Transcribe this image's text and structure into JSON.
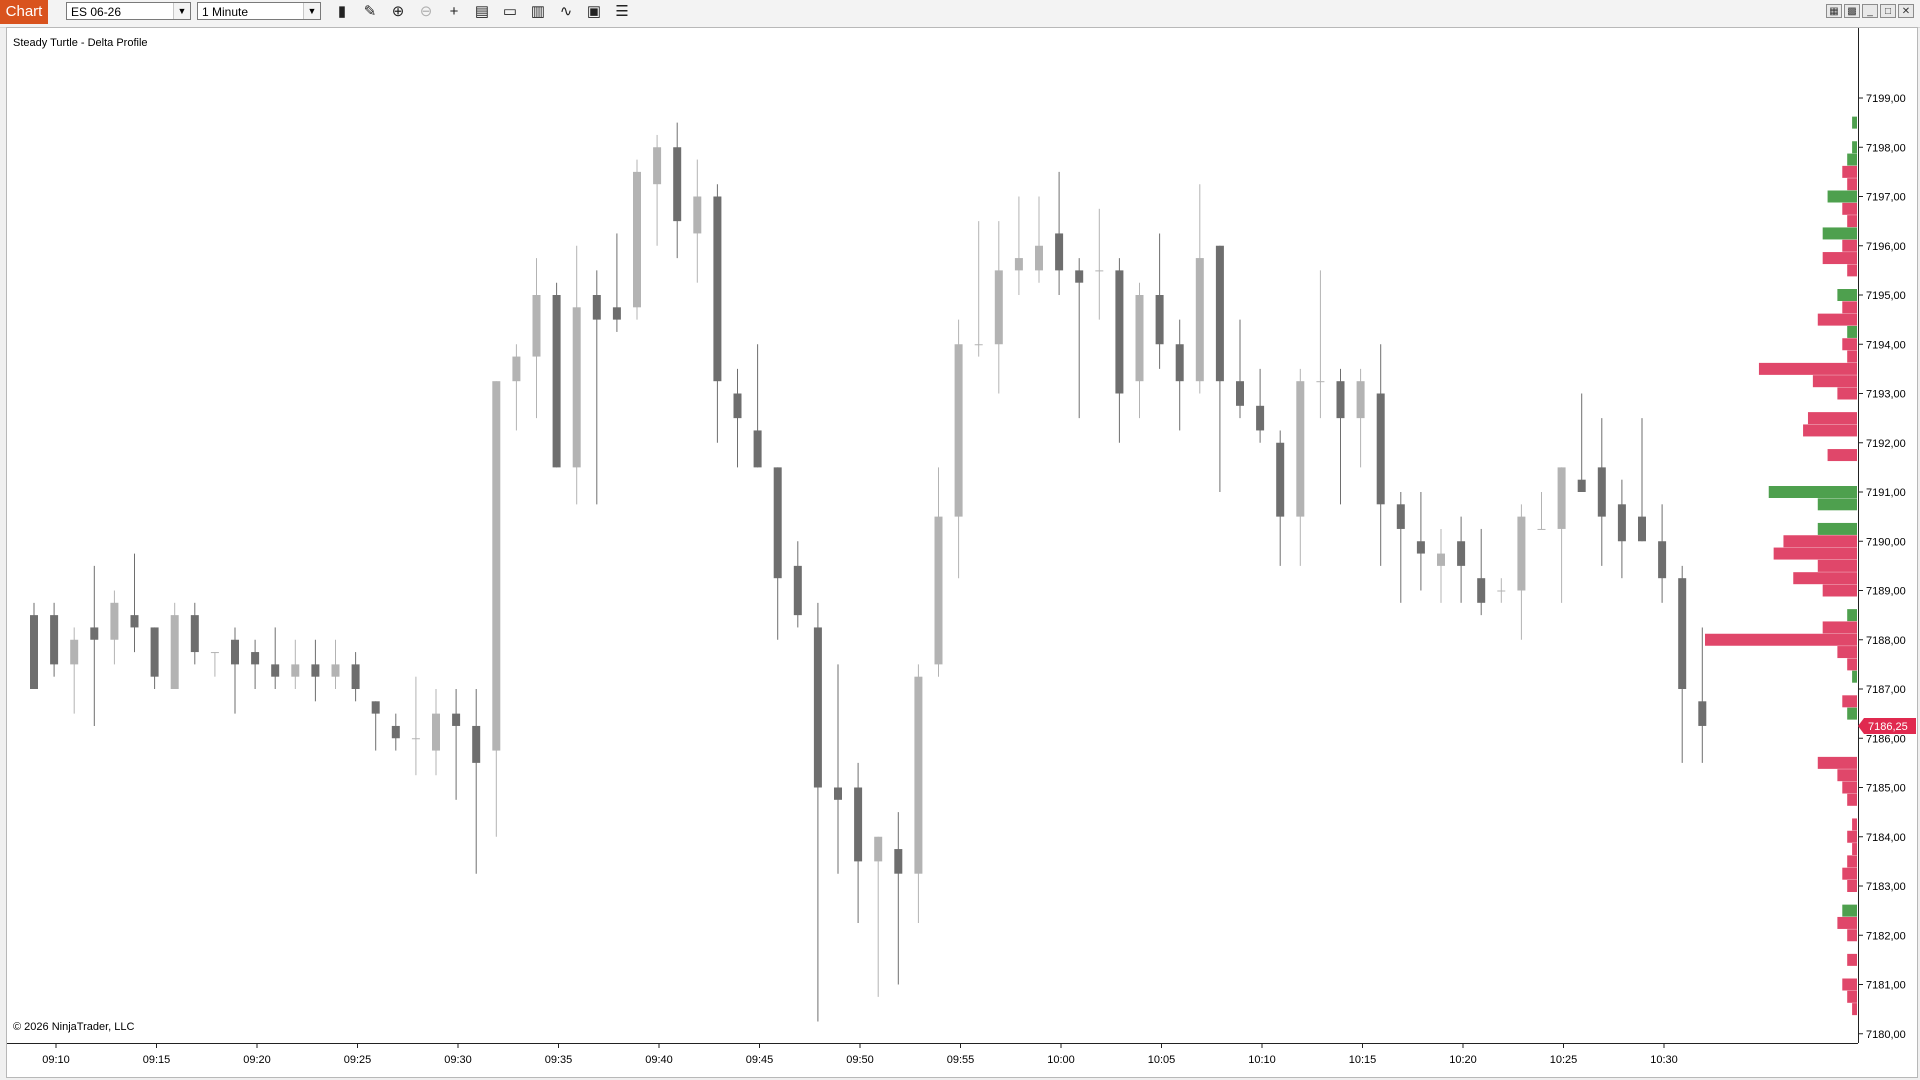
{
  "toolbar": {
    "chart_tab": "Chart",
    "instrument": "ES 06-26",
    "interval": "1 Minute",
    "tools": [
      {
        "name": "bars-type-icon",
        "glyph": "▮",
        "enabled": true
      },
      {
        "name": "draw-tool-icon",
        "glyph": "✎",
        "enabled": true
      },
      {
        "name": "zoom-in-icon",
        "glyph": "⊕",
        "enabled": true
      },
      {
        "name": "zoom-out-icon",
        "glyph": "⊖",
        "enabled": false
      },
      {
        "name": "crosshair-icon",
        "glyph": "+",
        "enabled": true
      },
      {
        "name": "data-box-icon",
        "glyph": "▤",
        "enabled": true
      },
      {
        "name": "chart-trader-icon",
        "glyph": "▭",
        "enabled": true
      },
      {
        "name": "indicators-icon",
        "glyph": "▥",
        "enabled": true
      },
      {
        "name": "strategies-icon",
        "glyph": "∿",
        "enabled": true
      },
      {
        "name": "templates-icon",
        "glyph": "▣",
        "enabled": true
      },
      {
        "name": "properties-icon",
        "glyph": "☰",
        "enabled": true
      }
    ],
    "window_buttons": [
      {
        "name": "tile-icon",
        "glyph": "▦"
      },
      {
        "name": "link-icon",
        "glyph": "▩"
      },
      {
        "name": "minimize-icon",
        "glyph": "_"
      },
      {
        "name": "maximize-icon",
        "glyph": "□"
      },
      {
        "name": "close-icon",
        "glyph": "✕"
      }
    ]
  },
  "chart": {
    "indicator_label": "Steady Turtle - Delta Profile",
    "copyright": "© 2026 NinjaTrader, LLC",
    "current_price_label": "7186,25",
    "colors": {
      "candle_down": "#6e6e6e",
      "candle_up": "#b3b3b3",
      "delta_negative": "#e0476a",
      "delta_positive": "#4ea04e",
      "price_marker": "#e0294f"
    }
  },
  "chart_data": {
    "type": "candlestick",
    "instrument": "ES 06-26",
    "interval": "1 Minute",
    "x_ticks": [
      "09:10",
      "09:15",
      "09:20",
      "09:25",
      "09:30",
      "09:35",
      "09:40",
      "09:45",
      "09:50",
      "09:55",
      "10:00",
      "10:05",
      "10:10",
      "10:15",
      "10:20",
      "10:25",
      "10:30"
    ],
    "y_ticks": [
      "7180,00",
      "7181,00",
      "7182,00",
      "7183,00",
      "7184,00",
      "7185,00",
      "7186,00",
      "7187,00",
      "7188,00",
      "7189,00",
      "7190,00",
      "7191,00",
      "7192,00",
      "7193,00",
      "7194,00",
      "7195,00",
      "7196,00",
      "7197,00",
      "7198,00",
      "7199,00"
    ],
    "ylim": [
      7179.5,
      7199.5
    ],
    "current_price": 7186.25,
    "candles": [
      {
        "t": "09:09",
        "o": 7188.5,
        "h": 7188.75,
        "l": 7187.0,
        "c": 7187.0
      },
      {
        "t": "09:10",
        "o": 7188.5,
        "h": 7188.75,
        "l": 7187.25,
        "c": 7187.5
      },
      {
        "t": "09:11",
        "o": 7187.5,
        "h": 7188.25,
        "l": 7186.5,
        "c": 7188.0
      },
      {
        "t": "09:12",
        "o": 7188.25,
        "h": 7189.5,
        "l": 7186.25,
        "c": 7188.0
      },
      {
        "t": "09:13",
        "o": 7188.0,
        "h": 7189.0,
        "l": 7187.5,
        "c": 7188.75
      },
      {
        "t": "09:14",
        "o": 7188.5,
        "h": 7189.75,
        "l": 7187.75,
        "c": 7188.25
      },
      {
        "t": "09:15",
        "o": 7188.25,
        "h": 7188.25,
        "l": 7187.0,
        "c": 7187.25
      },
      {
        "t": "09:16",
        "o": 7187.0,
        "h": 7188.75,
        "l": 7187.0,
        "c": 7188.5
      },
      {
        "t": "09:17",
        "o": 7188.5,
        "h": 7188.75,
        "l": 7187.5,
        "c": 7187.75
      },
      {
        "t": "09:18",
        "o": 7187.75,
        "h": 7187.75,
        "l": 7187.25,
        "c": 7187.75
      },
      {
        "t": "09:19",
        "o": 7188.0,
        "h": 7188.25,
        "l": 7186.5,
        "c": 7187.5
      },
      {
        "t": "09:20",
        "o": 7187.75,
        "h": 7188.0,
        "l": 7187.0,
        "c": 7187.5
      },
      {
        "t": "09:21",
        "o": 7187.5,
        "h": 7188.25,
        "l": 7187.0,
        "c": 7187.25
      },
      {
        "t": "09:22",
        "o": 7187.25,
        "h": 7188.0,
        "l": 7187.0,
        "c": 7187.5
      },
      {
        "t": "09:23",
        "o": 7187.5,
        "h": 7188.0,
        "l": 7186.75,
        "c": 7187.25
      },
      {
        "t": "09:24",
        "o": 7187.25,
        "h": 7188.0,
        "l": 7187.0,
        "c": 7187.5
      },
      {
        "t": "09:25",
        "o": 7187.5,
        "h": 7187.75,
        "l": 7186.75,
        "c": 7187.0
      },
      {
        "t": "09:26",
        "o": 7186.75,
        "h": 7186.75,
        "l": 7185.75,
        "c": 7186.5
      },
      {
        "t": "09:27",
        "o": 7186.25,
        "h": 7186.5,
        "l": 7185.75,
        "c": 7186.0
      },
      {
        "t": "09:28",
        "o": 7186.0,
        "h": 7187.25,
        "l": 7185.25,
        "c": 7186.0
      },
      {
        "t": "09:29",
        "o": 7185.75,
        "h": 7187.0,
        "l": 7185.25,
        "c": 7186.5
      },
      {
        "t": "09:30",
        "o": 7186.5,
        "h": 7187.0,
        "l": 7184.75,
        "c": 7186.25
      },
      {
        "t": "09:31",
        "o": 7186.25,
        "h": 7187.0,
        "l": 7183.25,
        "c": 7185.5
      },
      {
        "t": "09:32",
        "o": 7185.75,
        "h": 7193.25,
        "l": 7184.0,
        "c": 7193.25
      },
      {
        "t": "09:33",
        "o": 7193.25,
        "h": 7194.0,
        "l": 7192.25,
        "c": 7193.75
      },
      {
        "t": "09:34",
        "o": 7193.75,
        "h": 7195.75,
        "l": 7192.5,
        "c": 7195.0
      },
      {
        "t": "09:35",
        "o": 7195.0,
        "h": 7195.25,
        "l": 7191.5,
        "c": 7191.5
      },
      {
        "t": "09:36",
        "o": 7191.5,
        "h": 7196.0,
        "l": 7190.75,
        "c": 7194.75
      },
      {
        "t": "09:37",
        "o": 7195.0,
        "h": 7195.5,
        "l": 7190.75,
        "c": 7194.5
      },
      {
        "t": "09:38",
        "o": 7194.75,
        "h": 7196.25,
        "l": 7194.25,
        "c": 7194.5
      },
      {
        "t": "09:39",
        "o": 7194.75,
        "h": 7197.75,
        "l": 7194.5,
        "c": 7197.5
      },
      {
        "t": "09:40",
        "o": 7197.25,
        "h": 7198.25,
        "l": 7196.0,
        "c": 7198.0
      },
      {
        "t": "09:41",
        "o": 7198.0,
        "h": 7198.5,
        "l": 7195.75,
        "c": 7196.5
      },
      {
        "t": "09:42",
        "o": 7196.25,
        "h": 7197.75,
        "l": 7195.25,
        "c": 7197.0
      },
      {
        "t": "09:43",
        "o": 7197.0,
        "h": 7197.25,
        "l": 7192.0,
        "c": 7193.25
      },
      {
        "t": "09:44",
        "o": 7193.0,
        "h": 7193.5,
        "l": 7191.5,
        "c": 7192.5
      },
      {
        "t": "09:45",
        "o": 7192.25,
        "h": 7194.0,
        "l": 7191.5,
        "c": 7191.5
      },
      {
        "t": "09:46",
        "o": 7191.5,
        "h": 7191.5,
        "l": 7188.0,
        "c": 7189.25
      },
      {
        "t": "09:47",
        "o": 7189.5,
        "h": 7190.0,
        "l": 7188.25,
        "c": 7188.5
      },
      {
        "t": "09:48",
        "o": 7188.25,
        "h": 7188.75,
        "l": 7180.25,
        "c": 7185.0
      },
      {
        "t": "09:49",
        "o": 7185.0,
        "h": 7187.5,
        "l": 7183.25,
        "c": 7184.75
      },
      {
        "t": "09:50",
        "o": 7185.0,
        "h": 7185.5,
        "l": 7182.25,
        "c": 7183.5
      },
      {
        "t": "09:51",
        "o": 7183.5,
        "h": 7184.0,
        "l": 7180.75,
        "c": 7184.0
      },
      {
        "t": "09:52",
        "o": 7183.75,
        "h": 7184.5,
        "l": 7181.0,
        "c": 7183.25
      },
      {
        "t": "09:53",
        "o": 7183.25,
        "h": 7187.5,
        "l": 7182.25,
        "c": 7187.25
      },
      {
        "t": "09:54",
        "o": 7187.5,
        "h": 7191.5,
        "l": 7187.25,
        "c": 7190.5
      },
      {
        "t": "09:55",
        "o": 7190.5,
        "h": 7194.5,
        "l": 7189.25,
        "c": 7194.0
      },
      {
        "t": "09:56",
        "o": 7194.0,
        "h": 7196.5,
        "l": 7193.75,
        "c": 7194.0
      },
      {
        "t": "09:57",
        "o": 7194.0,
        "h": 7196.5,
        "l": 7193.0,
        "c": 7195.5
      },
      {
        "t": "09:58",
        "o": 7195.5,
        "h": 7197.0,
        "l": 7195.0,
        "c": 7195.75
      },
      {
        "t": "09:59",
        "o": 7195.5,
        "h": 7197.0,
        "l": 7195.25,
        "c": 7196.0
      },
      {
        "t": "10:00",
        "o": 7196.25,
        "h": 7197.5,
        "l": 7195.0,
        "c": 7195.5
      },
      {
        "t": "10:01",
        "o": 7195.5,
        "h": 7195.75,
        "l": 7192.5,
        "c": 7195.25
      },
      {
        "t": "10:02",
        "o": 7195.5,
        "h": 7196.75,
        "l": 7194.5,
        "c": 7195.5
      },
      {
        "t": "10:03",
        "o": 7195.5,
        "h": 7195.75,
        "l": 7192.0,
        "c": 7193.0
      },
      {
        "t": "10:04",
        "o": 7193.25,
        "h": 7195.25,
        "l": 7192.5,
        "c": 7195.0
      },
      {
        "t": "10:05",
        "o": 7195.0,
        "h": 7196.25,
        "l": 7193.5,
        "c": 7194.0
      },
      {
        "t": "10:06",
        "o": 7194.0,
        "h": 7194.5,
        "l": 7192.25,
        "c": 7193.25
      },
      {
        "t": "10:07",
        "o": 7193.25,
        "h": 7197.25,
        "l": 7193.0,
        "c": 7195.75
      },
      {
        "t": "10:08",
        "o": 7196.0,
        "h": 7196.0,
        "l": 7191.0,
        "c": 7193.25
      },
      {
        "t": "10:09",
        "o": 7193.25,
        "h": 7194.5,
        "l": 7192.5,
        "c": 7192.75
      },
      {
        "t": "10:10",
        "o": 7192.75,
        "h": 7193.5,
        "l": 7192.0,
        "c": 7192.25
      },
      {
        "t": "10:11",
        "o": 7192.0,
        "h": 7192.25,
        "l": 7189.5,
        "c": 7190.5
      },
      {
        "t": "10:12",
        "o": 7190.5,
        "h": 7193.5,
        "l": 7189.5,
        "c": 7193.25
      },
      {
        "t": "10:13",
        "o": 7193.25,
        "h": 7195.5,
        "l": 7192.5,
        "c": 7193.25
      },
      {
        "t": "10:14",
        "o": 7193.25,
        "h": 7193.5,
        "l": 7190.75,
        "c": 7192.5
      },
      {
        "t": "10:15",
        "o": 7192.5,
        "h": 7193.5,
        "l": 7191.5,
        "c": 7193.25
      },
      {
        "t": "10:16",
        "o": 7193.0,
        "h": 7194.0,
        "l": 7189.5,
        "c": 7190.75
      },
      {
        "t": "10:17",
        "o": 7190.75,
        "h": 7191.0,
        "l": 7188.75,
        "c": 7190.25
      },
      {
        "t": "10:18",
        "o": 7190.0,
        "h": 7191.0,
        "l": 7189.0,
        "c": 7189.75
      },
      {
        "t": "10:19",
        "o": 7189.5,
        "h": 7190.25,
        "l": 7188.75,
        "c": 7189.75
      },
      {
        "t": "10:20",
        "o": 7190.0,
        "h": 7190.5,
        "l": 7188.75,
        "c": 7189.5
      },
      {
        "t": "10:21",
        "o": 7189.25,
        "h": 7190.25,
        "l": 7188.5,
        "c": 7188.75
      },
      {
        "t": "10:22",
        "o": 7189.0,
        "h": 7189.25,
        "l": 7188.75,
        "c": 7189.0
      },
      {
        "t": "10:23",
        "o": 7189.0,
        "h": 7190.75,
        "l": 7188.0,
        "c": 7190.5
      },
      {
        "t": "10:24",
        "o": 7190.25,
        "h": 7191.0,
        "l": 7190.25,
        "c": 7190.25
      },
      {
        "t": "10:25",
        "o": 7190.25,
        "h": 7191.5,
        "l": 7188.75,
        "c": 7191.5
      },
      {
        "t": "10:26",
        "o": 7191.25,
        "h": 7193.0,
        "l": 7191.0,
        "c": 7191.0
      },
      {
        "t": "10:27",
        "o": 7191.5,
        "h": 7192.5,
        "l": 7189.5,
        "c": 7190.5
      },
      {
        "t": "10:28",
        "o": 7190.75,
        "h": 7191.25,
        "l": 7189.25,
        "c": 7190.0
      },
      {
        "t": "10:29",
        "o": 7190.5,
        "h": 7192.5,
        "l": 7190.0,
        "c": 7190.0
      },
      {
        "t": "10:30",
        "o": 7190.0,
        "h": 7190.75,
        "l": 7188.75,
        "c": 7189.25
      },
      {
        "t": "10:31",
        "o": 7189.25,
        "h": 7189.5,
        "l": 7185.5,
        "c": 7187.0
      },
      {
        "t": "10:32",
        "o": 7186.75,
        "h": 7188.25,
        "l": 7185.5,
        "c": 7186.25
      }
    ],
    "delta_profile": [
      {
        "price": 7198.5,
        "delta": 1
      },
      {
        "price": 7198.0,
        "delta": 1
      },
      {
        "price": 7197.75,
        "delta": 2
      },
      {
        "price": 7197.5,
        "delta": -3
      },
      {
        "price": 7197.25,
        "delta": -2
      },
      {
        "price": 7197.0,
        "delta": 6
      },
      {
        "price": 7196.75,
        "delta": -3
      },
      {
        "price": 7196.5,
        "delta": -2
      },
      {
        "price": 7196.25,
        "delta": 7
      },
      {
        "price": 7196.0,
        "delta": -3
      },
      {
        "price": 7195.75,
        "delta": -7
      },
      {
        "price": 7195.5,
        "delta": -2
      },
      {
        "price": 7195.0,
        "delta": 4
      },
      {
        "price": 7194.75,
        "delta": -3
      },
      {
        "price": 7194.5,
        "delta": -8
      },
      {
        "price": 7194.25,
        "delta": 2
      },
      {
        "price": 7194.0,
        "delta": -3
      },
      {
        "price": 7193.75,
        "delta": -2
      },
      {
        "price": 7193.5,
        "delta": -20
      },
      {
        "price": 7193.25,
        "delta": -9
      },
      {
        "price": 7193.0,
        "delta": -4
      },
      {
        "price": 7192.5,
        "delta": -10
      },
      {
        "price": 7192.25,
        "delta": -11
      },
      {
        "price": 7191.75,
        "delta": -6
      },
      {
        "price": 7191.0,
        "delta": 18
      },
      {
        "price": 7190.75,
        "delta": 8
      },
      {
        "price": 7190.25,
        "delta": 8
      },
      {
        "price": 7190.0,
        "delta": -15
      },
      {
        "price": 7189.75,
        "delta": -17
      },
      {
        "price": 7189.5,
        "delta": -8
      },
      {
        "price": 7189.25,
        "delta": -13
      },
      {
        "price": 7189.0,
        "delta": -7
      },
      {
        "price": 7188.5,
        "delta": 2
      },
      {
        "price": 7188.25,
        "delta": -7
      },
      {
        "price": 7188.0,
        "delta": -31
      },
      {
        "price": 7187.75,
        "delta": -4
      },
      {
        "price": 7187.5,
        "delta": -2
      },
      {
        "price": 7187.25,
        "delta": 1
      },
      {
        "price": 7186.75,
        "delta": -3
      },
      {
        "price": 7186.5,
        "delta": 2
      },
      {
        "price": 7185.5,
        "delta": -8
      },
      {
        "price": 7185.25,
        "delta": -4
      },
      {
        "price": 7185.0,
        "delta": -3
      },
      {
        "price": 7184.75,
        "delta": -2
      },
      {
        "price": 7184.25,
        "delta": -1
      },
      {
        "price": 7184.0,
        "delta": -2
      },
      {
        "price": 7183.75,
        "delta": -1
      },
      {
        "price": 7183.5,
        "delta": -2
      },
      {
        "price": 7183.25,
        "delta": -3
      },
      {
        "price": 7183.0,
        "delta": -2
      },
      {
        "price": 7182.5,
        "delta": 3
      },
      {
        "price": 7182.25,
        "delta": -4
      },
      {
        "price": 7182.0,
        "delta": -2
      },
      {
        "price": 7181.5,
        "delta": -2
      },
      {
        "price": 7181.0,
        "delta": -3
      },
      {
        "price": 7180.75,
        "delta": -2
      },
      {
        "price": 7180.5,
        "delta": -1
      }
    ]
  }
}
